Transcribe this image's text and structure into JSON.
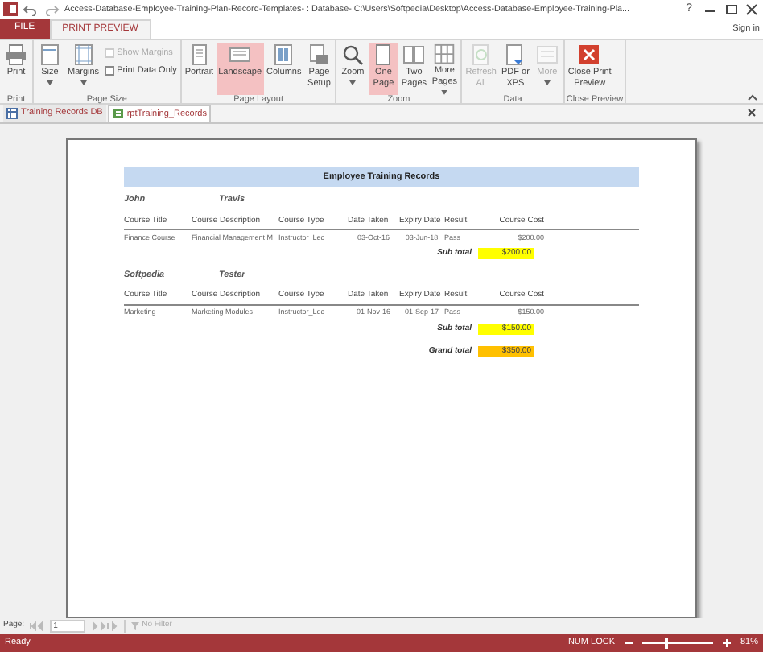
{
  "title_bar": {
    "title": "Access-Database-Employee-Training-Plan-Record-Templates- : Database- C:\\Users\\Softpedia\\Desktop\\Access-Database-Employee-Training-Pla...",
    "help": "?"
  },
  "ribbon_tabs": [
    {
      "label": "FILE",
      "kind": "file",
      "selected": false
    },
    {
      "label": "PRINT PREVIEW",
      "kind": "tab",
      "selected": true
    }
  ],
  "sign_in": "Sign in",
  "groups": [
    {
      "label": "Print",
      "items": [
        {
          "kind": "large",
          "label": "Print",
          "selected": false,
          "disabled": false,
          "dropdown": false
        }
      ]
    },
    {
      "label": "Page Size",
      "items": [
        {
          "kind": "large",
          "label": "Size",
          "selected": false,
          "disabled": false,
          "dropdown": true
        },
        {
          "kind": "large",
          "label": "Margins",
          "selected": false,
          "disabled": false,
          "dropdown": true
        },
        {
          "kind": "check",
          "label": "Show Margins",
          "checked": false,
          "disabled": true
        },
        {
          "kind": "check",
          "label": "Print Data Only",
          "checked": false,
          "disabled": false
        }
      ]
    },
    {
      "label": "Page Layout",
      "items": [
        {
          "kind": "large",
          "label": "Portrait",
          "selected": false,
          "disabled": false,
          "dropdown": false
        },
        {
          "kind": "large",
          "label": "Landscape",
          "selected": true,
          "disabled": false,
          "dropdown": false
        },
        {
          "kind": "large",
          "label": "Columns",
          "selected": false,
          "disabled": false,
          "dropdown": false
        },
        {
          "kind": "large",
          "label": "Page Setup",
          "selected": false,
          "disabled": false,
          "dropdown": false
        }
      ]
    },
    {
      "label": "Zoom",
      "items": [
        {
          "kind": "large",
          "label": "Zoom",
          "selected": false,
          "disabled": false,
          "dropdown": true
        },
        {
          "kind": "large",
          "label": "One Page",
          "selected": true,
          "disabled": false,
          "dropdown": false
        },
        {
          "kind": "large",
          "label": "Two Pages",
          "selected": false,
          "disabled": false,
          "dropdown": false
        },
        {
          "kind": "large",
          "label": "More Pages",
          "selected": false,
          "disabled": false,
          "dropdown": true
        }
      ]
    },
    {
      "label": "Data",
      "items": [
        {
          "kind": "large",
          "label": "Refresh All",
          "selected": false,
          "disabled": true,
          "dropdown": false
        },
        {
          "kind": "large",
          "label": "PDF or XPS",
          "selected": false,
          "disabled": false,
          "dropdown": false
        },
        {
          "kind": "large",
          "label": "More",
          "selected": false,
          "disabled": true,
          "dropdown": true
        }
      ]
    },
    {
      "label": "Close Preview",
      "items": [
        {
          "kind": "large",
          "label": "Close Print Preview",
          "selected": false,
          "disabled": false,
          "dropdown": false
        }
      ]
    }
  ],
  "doc_tabs": [
    {
      "label": "Training Records DB",
      "selected": false
    },
    {
      "label": "rptTraining_Records",
      "selected": true
    }
  ],
  "report": {
    "title": "Employee Training Records",
    "employees": [
      {
        "first_name": "John",
        "last_name": "Travis",
        "columns": [
          "Course Title",
          "Course Description",
          "Course Type",
          "Date Taken",
          "Expiry Date",
          "Result",
          "Course Cost"
        ],
        "rows": [
          [
            "Finance Course",
            "Financial Management M",
            "Instructor_Led",
            "03-Oct-16",
            "03-Jun-18",
            "Pass",
            "$200.00"
          ]
        ],
        "subtotal_label": "Sub total",
        "subtotal": "$200.00"
      },
      {
        "first_name": "Softpedia",
        "last_name": "Tester",
        "columns": [
          "Course Title",
          "Course Description",
          "Course Type",
          "Date Taken",
          "Expiry Date",
          "Result",
          "Course Cost"
        ],
        "rows": [
          [
            "Marketing",
            "Marketing Modules",
            "Instructor_Led",
            "01-Nov-16",
            "01-Sep-17",
            "Pass",
            "$150.00"
          ]
        ],
        "subtotal_label": "Sub total",
        "subtotal": "$150.00"
      }
    ],
    "grand_total_label": "Grand total",
    "grand_total": "$350.00"
  },
  "navigation": {
    "label": "Page:",
    "page": "1",
    "filter": "No Filter"
  },
  "status_bar": {
    "status": "Ready",
    "num_lock": "NUM LOCK",
    "zoom": {
      "level": 0.35
    },
    "zoom_reading": "81%"
  }
}
